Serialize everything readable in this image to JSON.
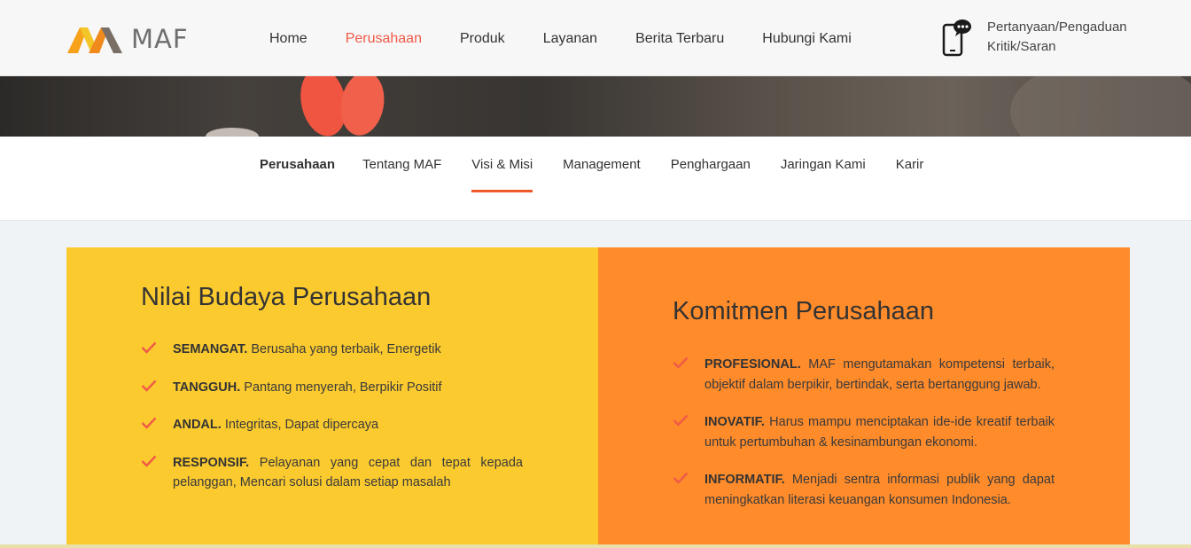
{
  "brand": {
    "logo_text": "MAF"
  },
  "nav": {
    "items": [
      {
        "label": "Home"
      },
      {
        "label": "Perusahaan",
        "active": true
      },
      {
        "label": "Produk"
      },
      {
        "label": "Layanan"
      },
      {
        "label": "Berita Terbaru"
      },
      {
        "label": "Hubungi Kami"
      }
    ]
  },
  "contact": {
    "line1": "Pertanyaan/Pengaduan",
    "line2": "Kritik/Saran",
    "icon": "phone-chat-icon"
  },
  "subnav": {
    "items": [
      {
        "label": "Perusahaan"
      },
      {
        "label": "Tentang MAF"
      },
      {
        "label": "Visi & Misi",
        "active": true
      },
      {
        "label": "Management"
      },
      {
        "label": "Penghargaan"
      },
      {
        "label": "Jaringan Kami"
      },
      {
        "label": "Karir"
      }
    ]
  },
  "values_panel": {
    "title": "Nilai Budaya Perusahaan",
    "items": [
      {
        "term": "SEMANGAT.",
        "text": "Berusaha yang terbaik, Energetik"
      },
      {
        "term": "TANGGUH.",
        "text": "Pantang menyerah, Berpikir Positif"
      },
      {
        "term": "ANDAL.",
        "text": "Integritas, Dapat dipercaya"
      },
      {
        "term": "RESPONSIF.",
        "text": "Pelayanan yang cepat dan tepat kepada pelanggan, Mencari solusi dalam setiap masalah"
      }
    ]
  },
  "commitment_panel": {
    "title": "Komitmen Perusahaan",
    "items": [
      {
        "term": "PROFESIONAL.",
        "text": "MAF mengutamakan kompetensi terbaik, objektif dalam berpikir, bertindak, serta bertanggung jawab."
      },
      {
        "term": "INOVATIF.",
        "text": "Harus mampu menciptakan ide-ide kreatif terbaik untuk pertumbuhan & kesinambungan ekonomi."
      },
      {
        "term": "INFORMATIF.",
        "text": "Menjadi sentra informasi publik yang dapat meningkatkan literasi keuangan konsumen Indonesia."
      }
    ]
  },
  "colors": {
    "accent": "#ef5a47",
    "values_bg": "#fbca2f",
    "commitment_bg": "#ff8b2b",
    "check": "#ef5a47",
    "underline": "#ef5a2b"
  }
}
